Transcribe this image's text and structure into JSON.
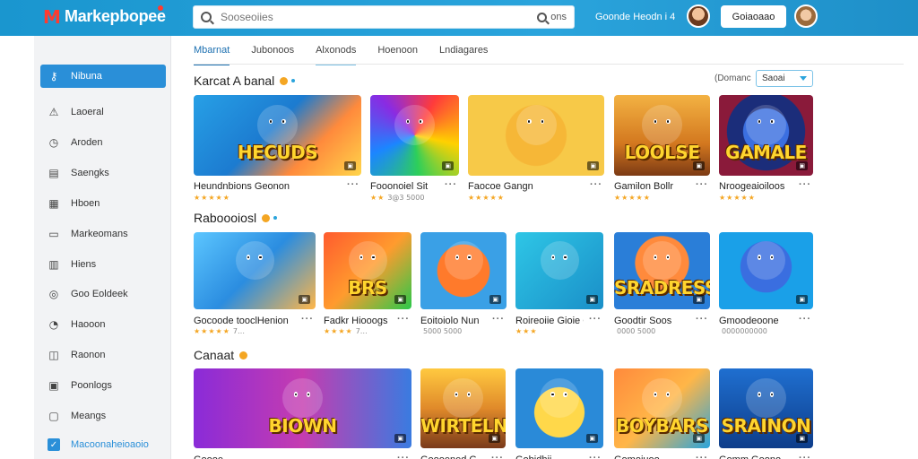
{
  "header": {
    "logo_mark": "M",
    "logo_text": "Markepbopee",
    "search_placeholder": "Sooseoiies",
    "search_right": "ons",
    "user_text": "Goonde Heodn i 4",
    "button_label": "Goiaoaao"
  },
  "sidebar": {
    "items": [
      {
        "label": "Nibuna",
        "icon": "key-icon",
        "glyph": "⚷",
        "active": true
      },
      {
        "label": "Laoeral",
        "icon": "warning-icon",
        "glyph": "⚠"
      },
      {
        "label": "Aroden",
        "icon": "clock-icon",
        "glyph": "◷"
      },
      {
        "label": "Saengks",
        "icon": "chart-icon",
        "glyph": "▤"
      },
      {
        "label": "Hboen",
        "icon": "grid-icon",
        "glyph": "▦"
      },
      {
        "label": "Markeomans",
        "icon": "window-icon",
        "glyph": "▭"
      },
      {
        "label": "Hiens",
        "icon": "bar-icon",
        "glyph": "▥"
      },
      {
        "label": "Goo Eoldeek",
        "icon": "settings-icon",
        "glyph": "◎"
      },
      {
        "label": "Haooon",
        "icon": "bell-icon",
        "glyph": "◔"
      },
      {
        "label": "Raonon",
        "icon": "bookmark-icon",
        "glyph": "◫"
      },
      {
        "label": "Poonlogs",
        "icon": "image-icon",
        "glyph": "▣"
      },
      {
        "label": "Meangs",
        "icon": "message-icon",
        "glyph": "▢"
      },
      {
        "label": "Macoonaheioaoio",
        "icon": "checkbox-icon",
        "glyph": "✓",
        "checked": true
      }
    ]
  },
  "tabs": [
    "Mbarnat",
    "Jubonoos",
    "Alxonods",
    "Hoenoon",
    "Lndiagares"
  ],
  "sort": {
    "label": "(Domanc",
    "value": "Saoai"
  },
  "sections": [
    {
      "title": "Karcat A banal",
      "cards": [
        {
          "title": "Heundnbions Geonon",
          "rating": 5,
          "meta": "",
          "label": "HECUDS",
          "bg": "linear-gradient(135deg,#27a0e6 0%,#1c7bd0 45%,#ff8a3c 70%,#ffd54a 100%)"
        },
        {
          "title": "Fooonoiel Sit",
          "rating": 2,
          "meta": "3@3 5000",
          "label": "",
          "bg": "conic-gradient(from 30deg,#ff3b3b,#ffd100,#2dcf5a,#1b86ff,#8a2be2,#ff3b3b)"
        },
        {
          "title": "Faocoe Gangn",
          "rating": 5,
          "meta": "",
          "label": "",
          "bg": "radial-gradient(circle at 50% 50%,#f6b737 0 38%,#f7c948 39% 100%)"
        },
        {
          "title": "Gamilon Bollr",
          "rating": 5,
          "meta": "",
          "label": "LOOLSE",
          "bg": "linear-gradient(180deg,#f3b243 0%,#d3781f 60%,#7c3a14 100%)"
        },
        {
          "title": "Nroogeaioiloos",
          "rating": 5,
          "meta": "",
          "label": "GAMALE",
          "bg": "radial-gradient(circle at 50% 45%,#3b6fe0 0 35%,#1b2d7a 36% 60%,#8a1a3a 61% 100%)"
        }
      ]
    },
    {
      "title": "Raboooiosl",
      "cards": [
        {
          "title": "Gocoode tooclHenion",
          "rating": 5,
          "meta": "7…",
          "label": "",
          "bg": "linear-gradient(135deg,#5cc6ff 0%,#2b8de0 50%,#ffb648 100%)"
        },
        {
          "title": "Fadkr Hiooogs",
          "rating": 4,
          "meta": "7…",
          "label": "BRS",
          "bg": "linear-gradient(135deg,#ff5b2e 0%,#ff9b2e 50%,#2ac94a 100%)"
        },
        {
          "title": "Eoitoiolo Nun",
          "rating": 0,
          "meta": "5000 5000",
          "label": "",
          "bg": "radial-gradient(circle at 50% 50%,#ff7a2b 0 45%,#3aa0e6 46% 100%)"
        },
        {
          "title": "Roireoiie Gioie Ch",
          "rating": 3,
          "meta": "",
          "label": "",
          "bg": "linear-gradient(135deg,#2ec6e6 0%,#1a8fc8 100%)"
        },
        {
          "title": "Goodtir Soos",
          "rating": 0,
          "meta": "0000 5000",
          "label": "SRADRESS",
          "bg": "radial-gradient(circle at 50% 40%,#ff8a3c 0 40%,#2a7ed8 41% 100%)"
        },
        {
          "title": "Gmoodeoone",
          "rating": 0,
          "meta": "0000000000",
          "label": "",
          "bg": "radial-gradient(circle at 50% 45%,#3a6ee0 0 40%,#1aa0e8 41% 100%)"
        }
      ]
    },
    {
      "title": "Canaat",
      "cards": [
        {
          "title": "Goooe ...",
          "rating": 0,
          "meta": "",
          "label": "BIOWN",
          "bg": "linear-gradient(90deg,#8a2bd8 0%,#c53cb0 50%,#3a7be0 100%)"
        },
        {
          "title": "Goooened G",
          "rating": 0,
          "meta": "",
          "label": "WIRTELN",
          "bg": "linear-gradient(180deg,#ffc940 0%,#e08a2a 50%,#7a3a1a 100%)"
        },
        {
          "title": "Gobidhii",
          "rating": 0,
          "meta": "",
          "label": "",
          "bg": "radial-gradient(circle at 50% 55%,#ffd84a 0 40%,#2a8ad8 41% 100%)"
        },
        {
          "title": "Gomoiuoo...",
          "rating": 0,
          "meta": "",
          "label": "BOYBARS",
          "bg": "linear-gradient(135deg,#ff8a3c 0%,#ffb648 50%,#2aa4dc 100%)"
        },
        {
          "title": "Gomm Goono",
          "rating": 0,
          "meta": "",
          "label": "SRAINON",
          "bg": "linear-gradient(180deg,#1f6fd0 0%,#0e3d8a 100%)"
        }
      ]
    }
  ]
}
